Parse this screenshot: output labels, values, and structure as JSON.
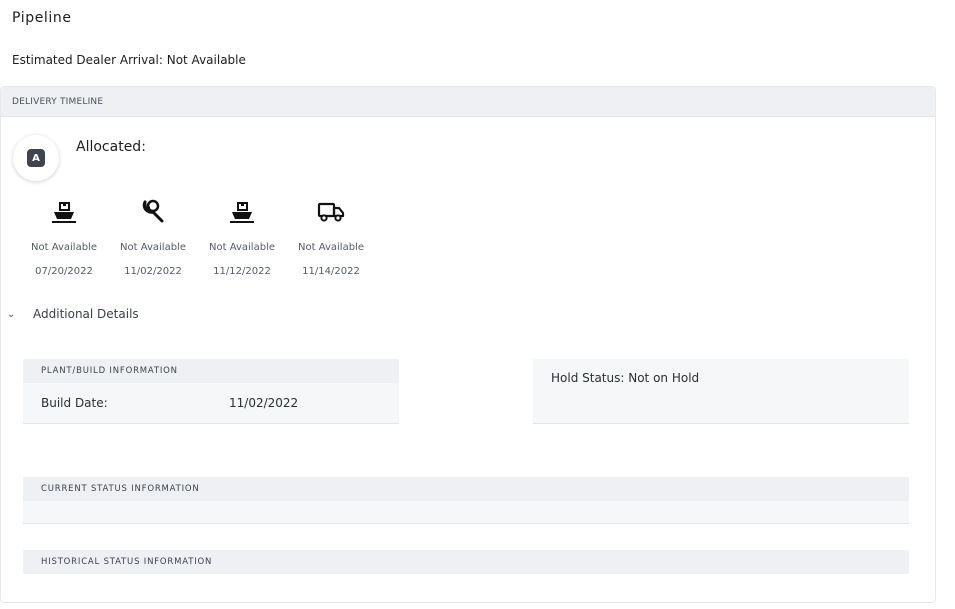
{
  "page": {
    "title": "Pipeline",
    "eta_label": "Estimated Dealer Arrival: Not Available"
  },
  "timeline": {
    "header": "DELIVERY TIMELINE",
    "avatar_letter": "A",
    "status_label": "Allocated:",
    "milestones": [
      {
        "icon": "ship-icon",
        "status": "Not Available",
        "date": "07/20/2022"
      },
      {
        "icon": "wrench-icon",
        "status": "Not Available",
        "date": "11/02/2022"
      },
      {
        "icon": "ship-icon",
        "status": "Not Available",
        "date": "11/12/2022"
      },
      {
        "icon": "truck-icon",
        "status": "Not Available",
        "date": "11/14/2022"
      }
    ]
  },
  "additional": {
    "toggle_icon": "chevron-down-icon",
    "label": "Additional Details"
  },
  "plant": {
    "header": "PLANT/BUILD INFORMATION",
    "build_date_label": "Build Date:",
    "build_date_value": "11/02/2022"
  },
  "hold": {
    "text": "Hold Status: Not on Hold"
  },
  "current_status": {
    "header": "CURRENT STATUS INFORMATION"
  },
  "historical_status": {
    "header": "HISTORICAL STATUS INFORMATION"
  }
}
